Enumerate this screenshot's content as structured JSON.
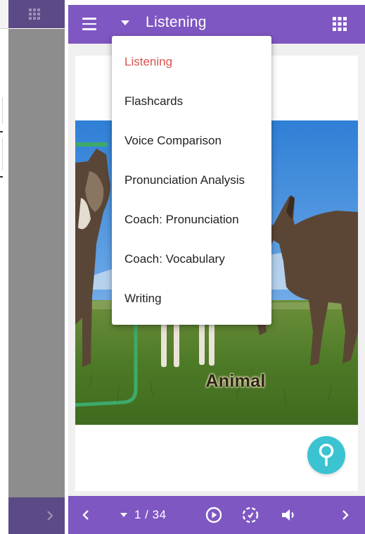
{
  "app": {
    "title": "Listening",
    "colors": {
      "primary": "#7e57c2",
      "accent": "#3cc3d2",
      "selected": "#d9534f"
    }
  },
  "menu": {
    "items": [
      {
        "label": "Listening",
        "selected": true
      },
      {
        "label": "Flashcards",
        "selected": false
      },
      {
        "label": "Voice Comparison",
        "selected": false
      },
      {
        "label": "Pronunciation Analysis",
        "selected": false
      },
      {
        "label": "Coach: Pronunciation",
        "selected": false
      },
      {
        "label": "Coach: Vocabulary",
        "selected": false
      },
      {
        "label": "Writing",
        "selected": false
      }
    ]
  },
  "card": {
    "caption": "Animal",
    "image_subject": "donkeys-in-grass-field"
  },
  "bottombar": {
    "pager": "1 / 34",
    "icons": [
      "chevron-left-icon",
      "play-circle-icon",
      "loop-icon",
      "volume-icon",
      "chevron-right-icon"
    ]
  },
  "background_app": {
    "icons": [
      "grid-icon",
      "chevron-right-icon"
    ]
  }
}
